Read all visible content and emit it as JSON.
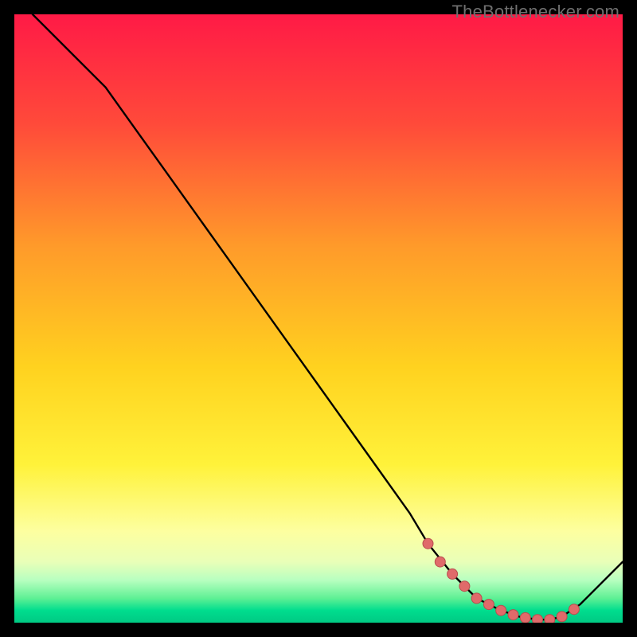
{
  "watermark": "TheBottlenecker.com",
  "colors": {
    "gradient_top": "#ff1a46",
    "gradient_mid1": "#ff7a2a",
    "gradient_mid2": "#ffd21f",
    "gradient_mid3": "#fff23a",
    "gradient_low": "#f8ffa8",
    "gradient_band": "#4de07e",
    "gradient_bottom": "#00d38a",
    "curve": "#000000",
    "marker_fill": "#e06a6a",
    "marker_stroke": "#b94d4d"
  },
  "chart_data": {
    "type": "line",
    "title": "",
    "xlabel": "",
    "ylabel": "",
    "xlim": [
      0,
      100
    ],
    "ylim": [
      0,
      100
    ],
    "series": [
      {
        "name": "bottleneck-curve",
        "x": [
          3,
          6,
          10,
          15,
          20,
          25,
          30,
          35,
          40,
          45,
          50,
          55,
          60,
          65,
          68,
          72,
          76,
          80,
          83,
          86,
          88,
          90,
          93,
          96,
          100
        ],
        "y": [
          100,
          97,
          93,
          88,
          81,
          74,
          67,
          60,
          53,
          46,
          39,
          32,
          25,
          18,
          13,
          8,
          4,
          2,
          1,
          0.5,
          0.5,
          1,
          3,
          6,
          10
        ]
      }
    ],
    "markers": {
      "name": "highlight-points",
      "x": [
        68,
        70,
        72,
        74,
        76,
        78,
        80,
        82,
        84,
        86,
        88,
        90,
        92
      ],
      "y": [
        13,
        10,
        8,
        6,
        4,
        3,
        2,
        1.3,
        0.8,
        0.5,
        0.5,
        1,
        2.2
      ]
    }
  }
}
